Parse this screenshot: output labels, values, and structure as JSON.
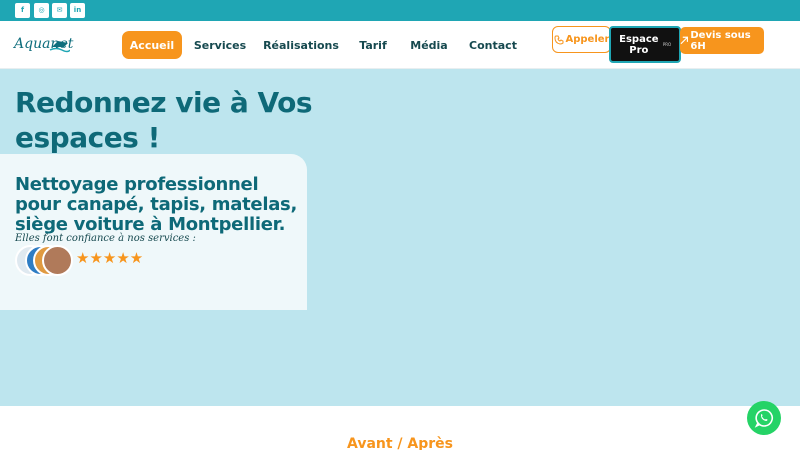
{
  "social": {
    "items": [
      {
        "name": "facebook",
        "glyph": "f"
      },
      {
        "name": "instagram",
        "glyph": "◎"
      },
      {
        "name": "email",
        "glyph": "✉"
      },
      {
        "name": "linkedin",
        "glyph": "in"
      }
    ]
  },
  "brand": {
    "logo_text": "Aquanet"
  },
  "nav": {
    "items": [
      {
        "label": "Accueil",
        "active": true
      },
      {
        "label": "Services",
        "active": false
      },
      {
        "label": "Réalisations",
        "active": false
      },
      {
        "label": "Tarif",
        "active": false
      },
      {
        "label": "Média",
        "active": false
      },
      {
        "label": "Contact",
        "active": false
      }
    ]
  },
  "actions": {
    "call_label": "Appeler",
    "pro_label": "Espace Pro",
    "pro_badge": "PRO",
    "devis_label": "Devis sous 6H"
  },
  "hero": {
    "title": "Redonnez vie à Vos espaces !",
    "subtitle": "Nettoyage professionnel pour canapé, tapis, matelas, siège voiture à Montpellier.",
    "trust_text": "Elles font confiance à nos services :",
    "rating_stars": 5,
    "stars_display": "★★★★★"
  },
  "section": {
    "title": "Avant / Après"
  },
  "colors": {
    "accent": "#f7951d",
    "teal": "#1fa6b4",
    "dark_teal": "#0e6978",
    "hero_bg": "#bde5ee",
    "whatsapp": "#25d366"
  }
}
